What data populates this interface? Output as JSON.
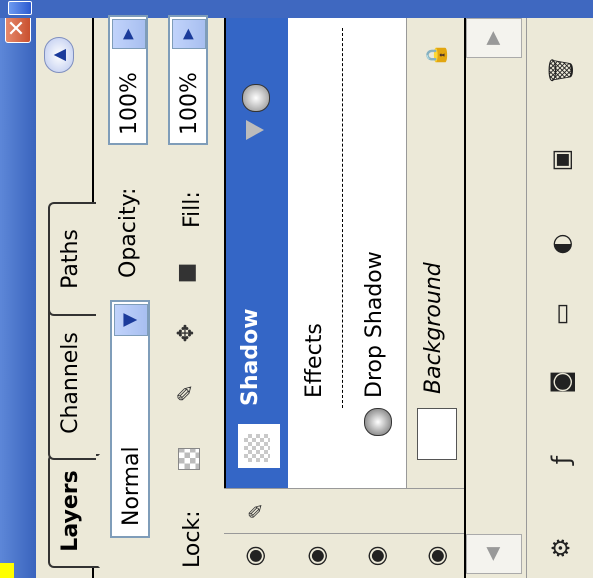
{
  "tabs": [
    {
      "label": "Layers"
    },
    {
      "label": "Channels"
    },
    {
      "label": "Paths"
    }
  ],
  "blend_mode": "Normal",
  "opacity": {
    "label": "Opacity:",
    "value": "100%"
  },
  "lock": {
    "label": "Lock:"
  },
  "fill": {
    "label": "Fill:",
    "value": "100%"
  },
  "layers": {
    "selected_layer": "Shadow",
    "effects_label": "Effects",
    "effect_item": "Drop Shadow",
    "background_layer": "Background"
  }
}
